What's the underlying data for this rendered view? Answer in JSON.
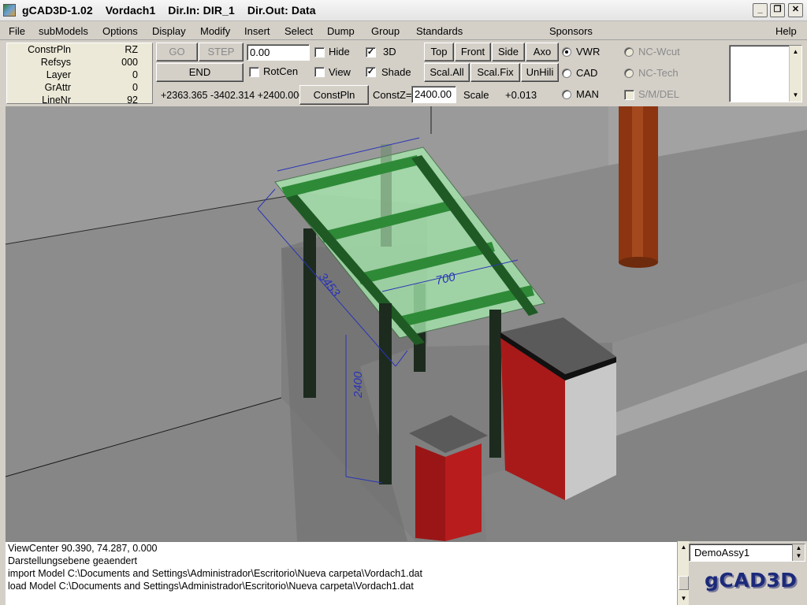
{
  "window": {
    "app_name": "gCAD3D-1.02",
    "model_name": "Vordach1",
    "dir_in": "Dir.In: DIR_1",
    "dir_out": "Dir.Out: Data"
  },
  "menu": [
    "File",
    "subModels",
    "Options",
    "Display",
    "Modify",
    "Insert",
    "Select",
    "Dump",
    "Group",
    "Standards",
    "Sponsors",
    "Help"
  ],
  "info_panel": [
    {
      "label": "ConstrPln",
      "value": "RZ"
    },
    {
      "label": "Refsys",
      "value": "000"
    },
    {
      "label": "Layer",
      "value": "0"
    },
    {
      "label": "GrAttr",
      "value": "0"
    },
    {
      "label": "LineNr",
      "value": "92"
    }
  ],
  "toolbar": {
    "go_label": "GO",
    "step_label": "STEP",
    "end_label": "END",
    "value_input": "0.00",
    "hide_label": "Hide",
    "hide_checked": false,
    "view_3d_label": "3D",
    "view_3d_checked": true,
    "rotcen_label": "RotCen",
    "rotcen_checked": false,
    "view_label": "View",
    "view_checked": false,
    "shade_label": "Shade",
    "shade_checked": true,
    "top_label": "Top",
    "front_label": "Front",
    "side_label": "Side",
    "axo_label": "Axo",
    "scal_all_label": "Scal.All",
    "scal_fix_label": "Scal.Fix",
    "unhili_label": "UnHili",
    "coordinates": "+2363.365  -3402.314  +2400.000",
    "constpln_label": "ConstPln",
    "constz_label": "ConstZ=",
    "constz_value": "2400.00",
    "scale_label": "Scale",
    "scale_value": "+0.013"
  },
  "modes": {
    "vwr": {
      "label": "VWR",
      "selected": true
    },
    "cad": {
      "label": "CAD",
      "selected": false
    },
    "man": {
      "label": "MAN",
      "selected": false
    },
    "nc_wcut": {
      "label": "NC-Wcut",
      "selected": false
    },
    "nc_tech": {
      "label": "NC-Tech",
      "selected": false
    },
    "smdel": {
      "label": "S/M/DEL",
      "checked": false
    }
  },
  "dimensions": [
    "3453",
    "700",
    "2400"
  ],
  "console": [
    "ViewCenter    90.390,   74.287,    0.000",
    "Darstellungsebene geaendert",
    "import Model C:\\Documents and Settings\\Administrador\\Escritorio\\Nueva carpeta\\Vordach1.dat",
    "load Model C:\\Documents and Settings\\Administrador\\Escritorio\\Nueva carpeta\\Vordach1.dat"
  ],
  "assembly": "DemoAssy1",
  "logo": "gCAD3D",
  "colors": {
    "wall": "#7a7a7a",
    "glass": "#9fe2a6",
    "beam": "#2f8a3a",
    "post": "#1d2a1f",
    "pipe": "#9a3a12",
    "box_red": "#b01a1a",
    "dimension": "#2a34b8"
  }
}
